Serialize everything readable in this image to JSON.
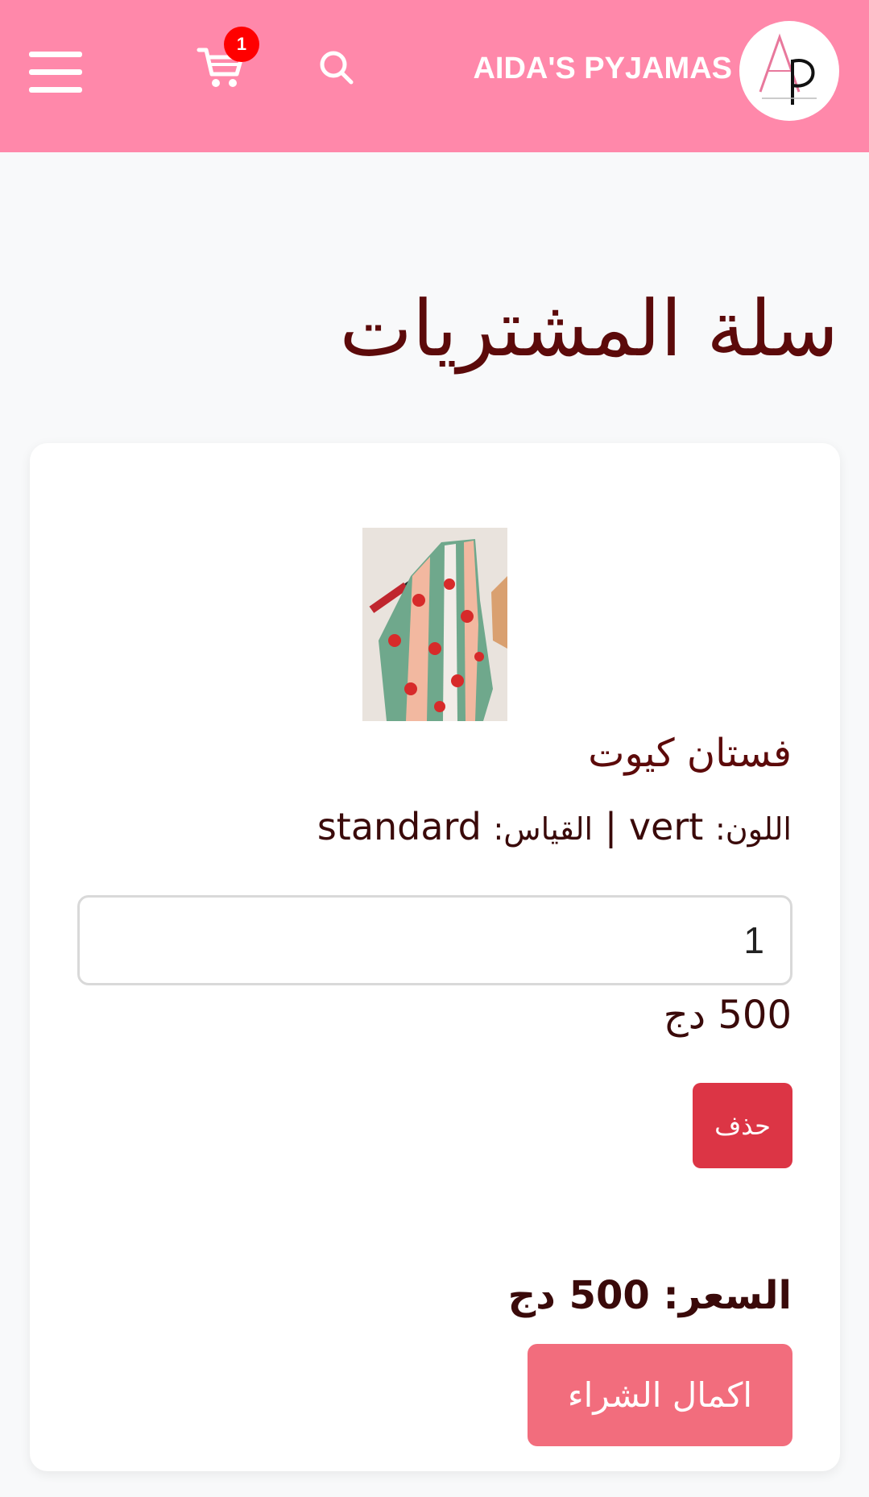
{
  "header": {
    "brand": "AIDA'S PYJAMAS",
    "cart_count": "1",
    "logo_icon": "ap-monogram-logo",
    "colors": {
      "header_bg": "#ff88aa",
      "badge_bg": "#ff0000"
    }
  },
  "page": {
    "title": "سلة المشتريات"
  },
  "cart": {
    "items": [
      {
        "name": "فستان كيوت",
        "color_label": "اللون:",
        "color_value": "vert",
        "separator": "|",
        "size_label": "القياس:",
        "size_value": "standard",
        "quantity": "1",
        "price": "500",
        "currency": "دج",
        "delete_label": "حذف"
      }
    ],
    "total_label": "السعر:",
    "total_value": "500",
    "total_currency": "دج",
    "checkout_label": "اكمال الشراء"
  },
  "colors": {
    "title_text": "#5c0a0a",
    "delete_button": "#dc3545",
    "checkout_button": "#f26d7d"
  }
}
